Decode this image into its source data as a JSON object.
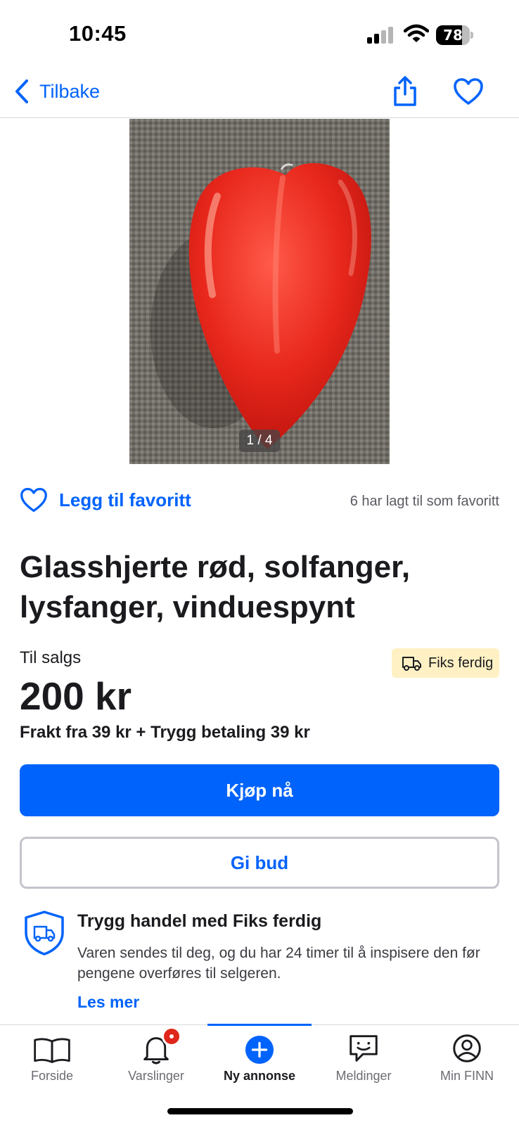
{
  "status_bar": {
    "time": "10:45",
    "battery": "78",
    "battery_level_percent": 78
  },
  "nav": {
    "back_label": "Tilbake",
    "icons": [
      "chevron-left-icon",
      "share-icon",
      "heart-outline-icon"
    ]
  },
  "image": {
    "counter": "1 / 4",
    "subject": "red-glass-heart"
  },
  "favorite": {
    "label": "Legg til favoritt",
    "count_text": "6 har lagt til som favoritt"
  },
  "listing": {
    "title": "Glasshjerte rød, solfanger, lysfanger, vinduespynt",
    "sale_label": "Til salgs",
    "badge_label": "Fiks ferdig",
    "price": "200 kr",
    "shipping": "Frakt fra 39 kr + Trygg betaling 39 kr"
  },
  "actions": {
    "buy_label": "Kjøp nå",
    "bid_label": "Gi bud"
  },
  "safe_trade": {
    "title": "Trygg handel med Fiks ferdig",
    "text": "Varen sendes til deg, og du har 24 timer til å inspisere den før pengene overføres til selgeren.",
    "link": "Les mer"
  },
  "tabs": [
    {
      "label": "Forside",
      "icon": "book-icon"
    },
    {
      "label": "Varslinger",
      "icon": "bell-icon"
    },
    {
      "label": "Ny annonse",
      "icon": "plus-circle-icon",
      "active": true
    },
    {
      "label": "Meldinger",
      "icon": "chat-icon"
    },
    {
      "label": "Min FINN",
      "icon": "profile-icon"
    }
  ],
  "colors": {
    "accent": "#0063fb",
    "badge_bg": "#fff1c4",
    "notification": "#e0251b",
    "text": "#1b1b1f"
  }
}
